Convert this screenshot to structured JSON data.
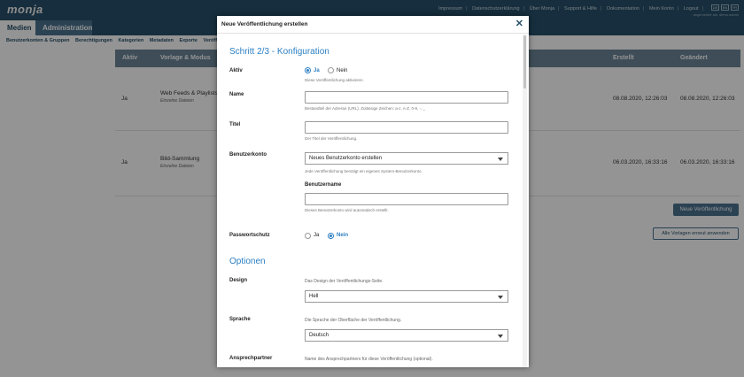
{
  "app": {
    "logo": "monja",
    "top_links": [
      "Impressum",
      "Datenschutzerklärung",
      "Über Monja",
      "Support & Hilfe",
      "Dokumentation",
      "Mein Konto",
      "Logout"
    ],
    "languages": [
      "DE",
      "EN",
      "FR"
    ],
    "user_info": "angemeldet als: demo.admin"
  },
  "main_nav": {
    "medien": "Medien",
    "administration": "Administration"
  },
  "sub_nav": [
    "Benutzerkonten & Gruppen",
    "Berechtigungen",
    "Kategorien",
    "Metadaten",
    "Exporte",
    "Veröffe"
  ],
  "table": {
    "headers": {
      "aktiv": "Aktiv",
      "vorlage": "Vorlage & Modus",
      "erstellt": "Erstellt",
      "geaendert": "Geändert"
    },
    "rows": [
      {
        "aktiv": "Ja",
        "name": "Web Feeds & Playlists",
        "mode": "Einzelne Dateien",
        "erstellt": "08.08.2020, 12:26:03",
        "geaendert": "08.08.2020, 12:26:03"
      },
      {
        "aktiv": "Ja",
        "name": "Bild-Sammlung",
        "mode": "Einzelne Dateien",
        "erstellt": "06.03.2020, 16:33:16",
        "geaendert": "06.03.2020, 16:33:16"
      }
    ],
    "btn_new": "Neue Veröffentlichung",
    "btn_all": "Alle Vorlagen erneut anwenden"
  },
  "modal": {
    "title": "Neue Veröffentlichung erstellen",
    "step_title": "Schritt 2/3 - Konfiguration",
    "aktiv": {
      "label": "Aktiv",
      "yes": "Ja",
      "no": "Nein",
      "hint": "Diese Veröffentlichung aktivieren."
    },
    "name": {
      "label": "Name",
      "value": "",
      "hint": "Bestandteil der Adresse (URL). Zulässige Zeichen: a-z, A-Z, 0-9, -, _"
    },
    "titel": {
      "label": "Titel",
      "value": "",
      "hint": "Der Titel der Veröffentlichung."
    },
    "benutzerkonto": {
      "label": "Benutzerkonto",
      "selected": "Neues Benutzerkonto erstellen",
      "hint": "Jede Veröffentlichung benötigt ein eigenes System-Benutzerkonto."
    },
    "benutzername": {
      "label": "Benutzername",
      "value": "",
      "hint": "Dieses Benutzerkonto wird automatisch erstellt."
    },
    "passwortschutz": {
      "label": "Passwortschutz",
      "yes": "Ja",
      "no": "Nein"
    },
    "optionen_title": "Optionen",
    "design": {
      "label": "Design",
      "desc": "Das Design der Veröffentlichungs-Seite.",
      "selected": "Hell"
    },
    "sprache": {
      "label": "Sprache",
      "desc": "Die Sprache der Oberfläche der Veröffentlichung.",
      "selected": "Deutsch"
    },
    "ansprechpartner": {
      "label": "Ansprechpartner",
      "desc": "Name des Ansprechpartners für diese Veröffentlichung (optional)."
    }
  },
  "colors": {
    "brand": "#26506a",
    "accent": "#2c7fc2",
    "table_header": "#6c8597"
  }
}
